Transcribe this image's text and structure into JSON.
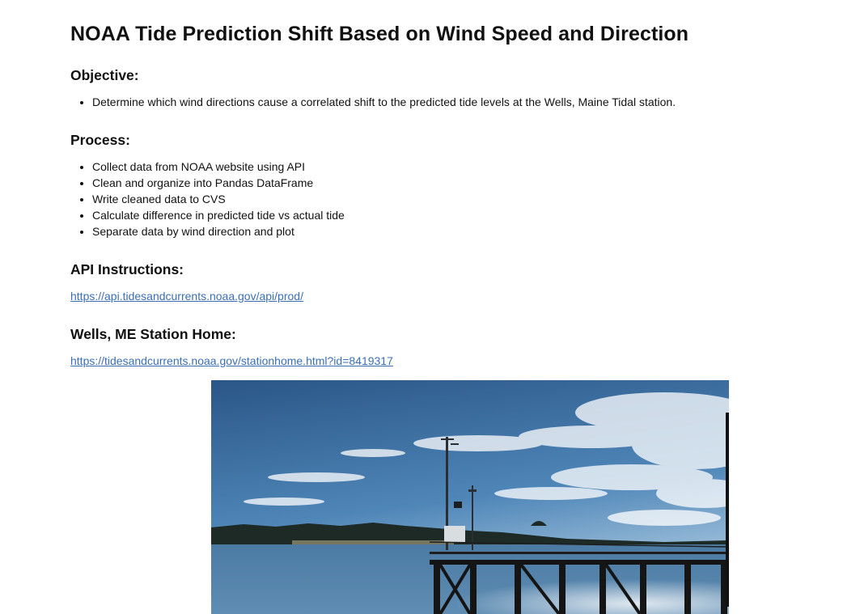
{
  "page": {
    "title": "NOAA Tide Prediction Shift Based on Wind Speed and Direction"
  },
  "objective": {
    "heading": "Objective:",
    "items": [
      "Determine which wind directions cause a correlated shift to the predicted tide levels at the Wells, Maine Tidal station."
    ]
  },
  "process": {
    "heading": "Process:",
    "items": [
      "Collect data from NOAA website using API",
      "Clean and organize into Pandas DataFrame",
      "Write cleaned data to CVS",
      "Calculate difference in predicted tide vs actual tide",
      "Separate data by wind direction and plot"
    ]
  },
  "api": {
    "heading": "API Instructions:",
    "link": "https://api.tidesandcurrents.noaa.gov/api/prod/"
  },
  "station": {
    "heading": "Wells, ME Station Home:",
    "link": "https://tidesandcurrents.noaa.gov/stationhome.html?id=8419317"
  },
  "colors": {
    "link": "#3b6fb5",
    "sky_top": "#2c5b8c",
    "water": "#3f6f9a"
  }
}
